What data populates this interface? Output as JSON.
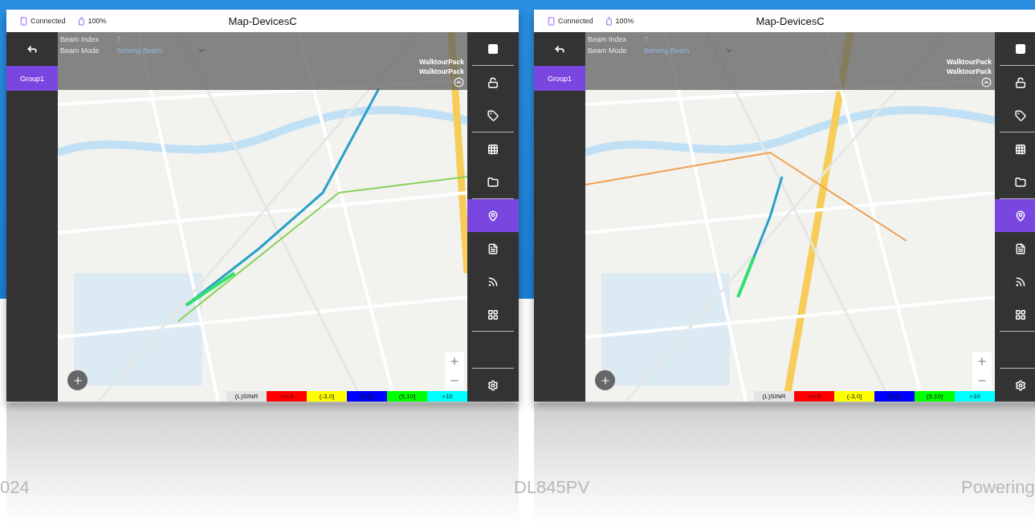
{
  "screens": [
    {
      "status": {
        "connection": "Connected",
        "battery": "100%"
      },
      "title": "Map-DevicesC",
      "groups": [
        {
          "label": "Group1",
          "selected": true
        }
      ],
      "beam": {
        "index_label": "Beam Index",
        "index_value": "7",
        "mode_label": "Beam Mode",
        "mode_value": "Serving Beam"
      },
      "packs": [
        "WalktourPack",
        "WalktourPack"
      ],
      "legend": {
        "title": "(L)SINR",
        "ranges": [
          {
            "label": "<=-3",
            "color": "#ff0000"
          },
          {
            "label": "(-3,0]",
            "color": "#ffff00"
          },
          {
            "label": "(0,5]",
            "color": "#0000ff"
          },
          {
            "label": "(5,10]",
            "color": "#00ff00"
          },
          {
            "label": ">10",
            "color": "#00ffff"
          }
        ]
      },
      "toolbar": [
        [
          {
            "kind": "stop",
            "selected": false
          }
        ],
        [
          {
            "kind": "unlock",
            "selected": false
          },
          {
            "kind": "tag",
            "selected": false
          }
        ],
        [
          {
            "kind": "table",
            "selected": false
          },
          {
            "kind": "folder",
            "selected": false
          }
        ],
        [
          {
            "kind": "map",
            "selected": true
          },
          {
            "kind": "document",
            "selected": false
          },
          {
            "kind": "signal",
            "selected": false
          },
          {
            "kind": "grid",
            "selected": false
          }
        ],
        [
          {
            "kind": "settings",
            "selected": false
          }
        ]
      ]
    },
    {
      "status": {
        "connection": "Connected",
        "battery": "100%"
      },
      "title": "Map-DevicesC",
      "groups": [
        {
          "label": "Group1",
          "selected": true
        }
      ],
      "beam": {
        "index_label": "Beam Index",
        "index_value": "7",
        "mode_label": "Beam Mode",
        "mode_value": "Serving Beam"
      },
      "packs": [
        "WalktourPack",
        "WalktourPack"
      ],
      "legend": {
        "title": "(L)SINR",
        "ranges": [
          {
            "label": "<=-3",
            "color": "#ff0000"
          },
          {
            "label": "(-3,0]",
            "color": "#ffff00"
          },
          {
            "label": "(0,5]",
            "color": "#0000ff"
          },
          {
            "label": "(5,10]",
            "color": "#00ff00"
          },
          {
            "label": ">10",
            "color": "#00ffff"
          }
        ]
      },
      "toolbar": [
        [
          {
            "kind": "stop",
            "selected": false
          }
        ],
        [
          {
            "kind": "unlock",
            "selected": false
          },
          {
            "kind": "tag",
            "selected": false
          }
        ],
        [
          {
            "kind": "table",
            "selected": false
          },
          {
            "kind": "folder",
            "selected": false
          }
        ],
        [
          {
            "kind": "map",
            "selected": true
          },
          {
            "kind": "document",
            "selected": false
          },
          {
            "kind": "signal",
            "selected": false
          },
          {
            "kind": "grid",
            "selected": false
          }
        ],
        [
          {
            "kind": "settings",
            "selected": false
          }
        ]
      ]
    }
  ],
  "captions": [
    "024",
    "DL845PV",
    "Powering"
  ]
}
